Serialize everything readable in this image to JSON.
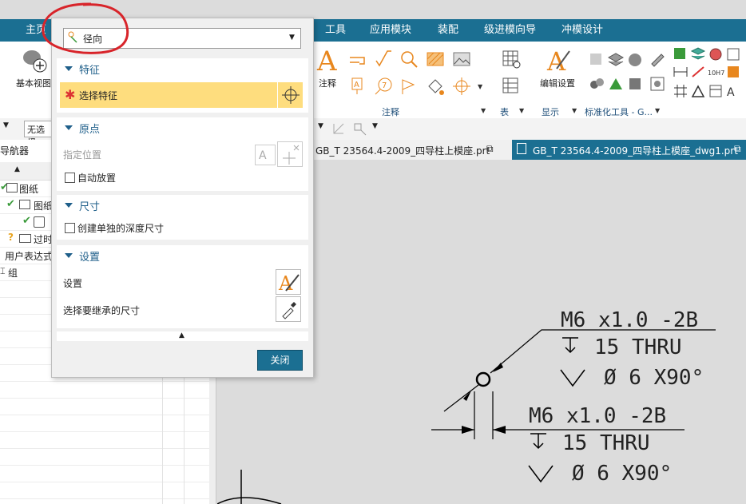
{
  "ribbon": {
    "tabs": [
      "主页",
      "工具",
      "应用模块",
      "装配",
      "级进模向导",
      "冲模设计"
    ],
    "basic_view_label": "基本视图",
    "annotation_label": "注释",
    "annotation_group": "注释",
    "table_group": "表",
    "edit_settings_label": "编辑设置",
    "display_group": "显示",
    "standard_tools_group": "标准化工具 - G..."
  },
  "toolbar": {
    "filter_value": "无选择"
  },
  "navigator": {
    "title": "导航器",
    "items": [
      "图纸",
      "图纸",
      "",
      "过时",
      "用户表达式",
      "组"
    ]
  },
  "doc_tabs": [
    {
      "label": "GB_T 23564.4-2009_四导柱上模座.prt",
      "active": false
    },
    {
      "label": "GB_T 23564.4-2009_四导柱上模座_dwg1.prt",
      "active": true
    }
  ],
  "dialog": {
    "type_value": "径向",
    "sections": {
      "feature": {
        "title": "特征",
        "select_label": "选择特征"
      },
      "origin": {
        "title": "原点",
        "specify_location": "指定位置",
        "auto_place": "自动放置"
      },
      "dimension": {
        "title": "尺寸",
        "create_depth": "创建单独的深度尺寸"
      },
      "settings": {
        "title": "设置",
        "settings_label": "设置",
        "inherit_label": "选择要继承的尺寸"
      }
    },
    "close_label": "关闭"
  },
  "drawing": {
    "callout1": {
      "line1": "M6 x1.0 -2B",
      "line2": "15 THRU",
      "line3": "Ø 6 X90°"
    },
    "callout2": {
      "line1": "M6 x1.0 -2B",
      "line2": "15 THRU",
      "line3": "Ø 6 X90°"
    }
  },
  "colors": {
    "ribbon": "#1b6f92",
    "highlight": "#fedd7e",
    "accent": "#1f5f8a",
    "close_button": "#1b6f92",
    "annotation_orange": "#e8871e"
  }
}
